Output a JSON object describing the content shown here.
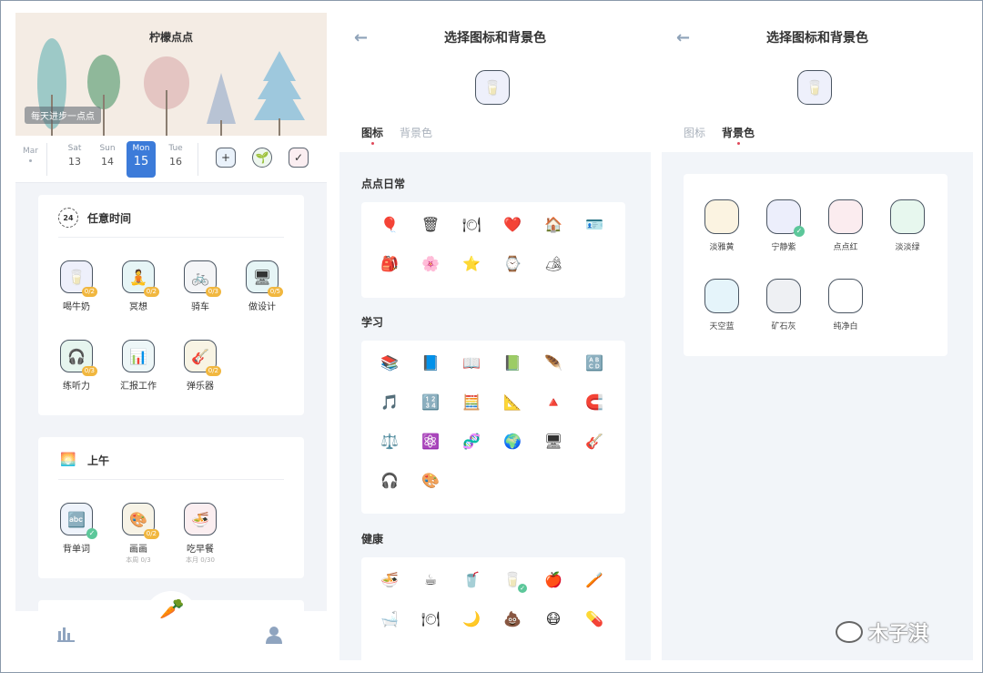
{
  "panel1": {
    "banner_title": "柠檬点点",
    "motto": "每天进步一点点",
    "month": "Mar",
    "days": [
      {
        "dow": "Sat",
        "num": "13"
      },
      {
        "dow": "Sun",
        "num": "14"
      },
      {
        "dow": "Mon",
        "num": "15",
        "selected": true
      },
      {
        "dow": "Tue",
        "num": "16"
      }
    ],
    "day_buttons": [
      "add-habit-icon",
      "sprout-icon",
      "calendar-check-icon"
    ],
    "card_anytime": {
      "header_icon_text": "24",
      "title": "任意时间",
      "habits": [
        {
          "label": "喝牛奶",
          "icon": "🥛",
          "badge": "0/2",
          "color": "#eef0fb"
        },
        {
          "label": "冥想",
          "icon": "🧘",
          "badge": "0/2",
          "color": "#e6f5f6"
        },
        {
          "label": "骑车",
          "icon": "🚲",
          "badge": "0/3",
          "color": "#f4f5f7"
        },
        {
          "label": "做设计",
          "icon": "🖥",
          "badge": "0/5",
          "color": "#e6f5f6"
        },
        {
          "label": "练听力",
          "icon": "🎧",
          "badge": "0/3",
          "color": "#e6f5ee"
        },
        {
          "label": "汇报工作",
          "icon": "📊",
          "badge": "",
          "color": "#eef7f8"
        },
        {
          "label": "弹乐器",
          "icon": "🎸",
          "badge": "0/2",
          "color": "#f8f4e4"
        }
      ]
    },
    "card_morning": {
      "header_icon": "sunrise-icon",
      "title": "上午",
      "habits": [
        {
          "label": "背单词",
          "icon": "🔤",
          "check": true,
          "sub": "",
          "color": "#eef3fb"
        },
        {
          "label": "画画",
          "icon": "🎨",
          "badge": "0/2",
          "sub": "本周 0/3",
          "color": "#f7f3e6"
        },
        {
          "label": "吃早餐",
          "icon": "🍜",
          "badge": "",
          "sub": "本月 0/30",
          "color": "#fbeef0"
        }
      ]
    },
    "tabbar": {
      "left_icon": "stats-icon",
      "center_icon": "radish-icon",
      "right_icon": "profile-icon"
    }
  },
  "panel2": {
    "title": "选择图标和背景色",
    "preview_icon": "🥛",
    "tabs": [
      "图标",
      "背景色"
    ],
    "active_tab": 0,
    "sections": [
      {
        "title": "点点日常",
        "icons": [
          "🎈",
          "🗑",
          "🍽",
          "❤️",
          "🏠",
          "🪪",
          "🎒",
          "🌸",
          "⭐",
          "⌚",
          "🏕"
        ]
      },
      {
        "title": "学习",
        "icons": [
          "📚",
          "📘",
          "📖",
          "📗",
          "🪶",
          "🔠",
          "🎵",
          "🔢",
          "🧮",
          "📐",
          "🔺",
          "🧲",
          "⚖️",
          "⚛️",
          "🧬",
          "🌍",
          "🖥",
          "🎸",
          "🎧",
          "🎨"
        ]
      },
      {
        "title": "健康",
        "icons": [
          "🍜",
          "☕",
          "🥤",
          "🥛",
          "🍎",
          "🪥",
          "🛁",
          "🍽",
          "🌙",
          "💩",
          "😷",
          "💊"
        ]
      }
    ]
  },
  "panel3": {
    "title": "选择图标和背景色",
    "preview_icon": "🥛",
    "tabs": [
      "图标",
      "背景色"
    ],
    "active_tab": 1,
    "swatches": [
      {
        "label": "淡雅黄",
        "color": "#fbf3e1"
      },
      {
        "label": "宁静紫",
        "color": "#eceefb",
        "selected": true
      },
      {
        "label": "点点红",
        "color": "#fbecef"
      },
      {
        "label": "淡淡绿",
        "color": "#e7f7ee"
      },
      {
        "label": "天空蓝",
        "color": "#e5f4fa"
      },
      {
        "label": "矿石灰",
        "color": "#eef0f3"
      },
      {
        "label": "纯净白",
        "color": "#ffffff"
      }
    ]
  },
  "watermark": "木子淇"
}
